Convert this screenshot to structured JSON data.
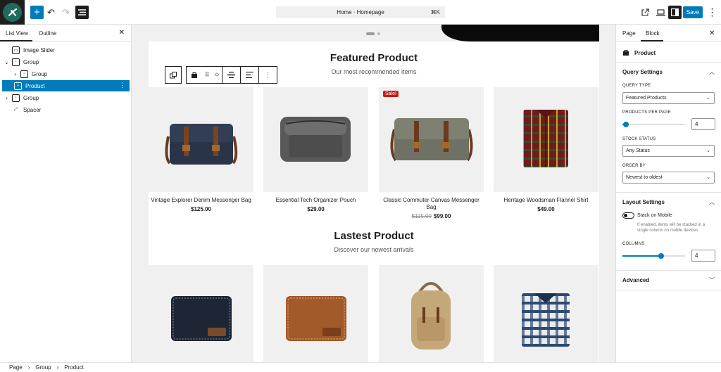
{
  "topbar": {
    "command_bar_label": "Home · Homepage",
    "command_shortcut": "⌘K",
    "save_label": "Save"
  },
  "list_view": {
    "tab_list_view": "List View",
    "tab_outline": "Outline",
    "items": [
      {
        "label": "Image Slider",
        "icon": "image-slider-icon"
      },
      {
        "label": "Group",
        "icon": "group-icon"
      },
      {
        "label": "Group",
        "icon": "group-icon"
      },
      {
        "label": "Product",
        "icon": "product-icon"
      },
      {
        "label": "Group",
        "icon": "group-icon"
      },
      {
        "label": "Spacer",
        "icon": "spacer-icon"
      }
    ]
  },
  "canvas": {
    "featured": {
      "title": "Featured Product",
      "subtitle": "Our most recommended items",
      "products": [
        {
          "name": "Vintage Explorer Denim Messenger Bag",
          "price": "$125.00",
          "old_price": null,
          "sale": false
        },
        {
          "name": "Essential Tech Organizer Pouch",
          "price": "$29.00",
          "old_price": null,
          "sale": false
        },
        {
          "name": "Classic Commuter Canvas Messenger Bag",
          "price": "$99.00",
          "old_price": "$115.00",
          "sale": true,
          "sale_label": "Sale!"
        },
        {
          "name": "Heritage Woodsman Flannel Shirt",
          "price": "$49.00",
          "old_price": null,
          "sale": false
        }
      ]
    },
    "latest": {
      "title": "Lastest Product",
      "subtitle": "Discover our newest arrivals"
    }
  },
  "settings": {
    "tab_page": "Page",
    "tab_block": "Block",
    "block_name": "Product",
    "query_settings": "Query Settings",
    "query_type_label": "QUERY TYPE",
    "query_type_value": "Featured Products",
    "products_per_page_label": "PRODUCTS PER PAGE",
    "products_per_page_value": "4",
    "stock_status_label": "STOCK STATUS",
    "stock_status_value": "Any Status",
    "order_by_label": "ORDER BY",
    "order_by_value": "Newest to oldest",
    "layout_settings": "Layout Settings",
    "stack_label": "Stack on Mobile",
    "stack_help": "If enabled, items will be stacked in a single column on mobile devices.",
    "columns_label": "COLUMNS",
    "columns_value": "4",
    "advanced": "Advanced"
  },
  "breadcrumb": [
    "Page",
    "Group",
    "Product"
  ],
  "colors": {
    "accent": "#007cba",
    "sale": "#cc1818",
    "dark": "#1e1e1e"
  }
}
